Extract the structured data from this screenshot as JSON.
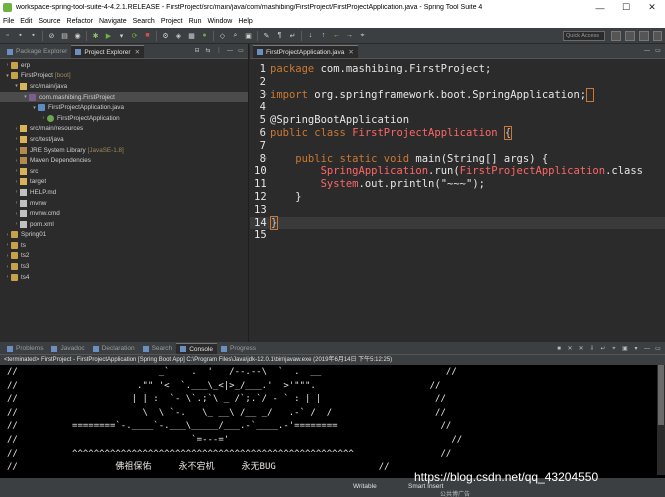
{
  "window": {
    "title": "workspace-spring-tool-suite-4-4.2.1.RELEASE - FirstProject/src/main/java/com/mashibing/FirstProject/FirstProjectApplication.java - Spring Tool Suite 4",
    "controls": [
      "—",
      "☐",
      "✕"
    ]
  },
  "menu": [
    "File",
    "Edit",
    "Source",
    "Refactor",
    "Navigate",
    "Search",
    "Project",
    "Run",
    "Window",
    "Help"
  ],
  "toolbar": {
    "quick_access": "Quick Access"
  },
  "explorer": {
    "tabs": [
      "Package Explorer",
      "Project Explorer"
    ],
    "active_tab": "Project Explorer",
    "items": [
      {
        "label": "erp",
        "extra": "",
        "icon": "project-icon",
        "indent": 0,
        "expanded": false,
        "selected": false
      },
      {
        "label": "FirstProject",
        "extra": "[boot]",
        "icon": "project-icon",
        "indent": 0,
        "expanded": true,
        "selected": false
      },
      {
        "label": "src/main/java",
        "extra": "",
        "icon": "source-folder-icon",
        "indent": 1,
        "expanded": true,
        "selected": false
      },
      {
        "label": "com.mashibing.FirstProject",
        "extra": "",
        "icon": "package-icon",
        "indent": 2,
        "expanded": true,
        "selected": true
      },
      {
        "label": "FirstProjectApplication.java",
        "extra": "",
        "icon": "java-file-icon",
        "indent": 3,
        "expanded": true,
        "selected": false
      },
      {
        "label": "FirstProjectApplication",
        "extra": "",
        "icon": "class-icon",
        "indent": 4,
        "expanded": false,
        "selected": false
      },
      {
        "label": "src/main/resources",
        "extra": "",
        "icon": "source-folder-icon",
        "indent": 1,
        "expanded": false,
        "selected": false
      },
      {
        "label": "src/test/java",
        "extra": "",
        "icon": "source-folder-icon",
        "indent": 1,
        "expanded": false,
        "selected": false
      },
      {
        "label": "JRE System Library",
        "extra": "[JavaSE-1.8]",
        "icon": "library-icon",
        "indent": 1,
        "expanded": false,
        "selected": false
      },
      {
        "label": "Maven Dependencies",
        "extra": "",
        "icon": "library-icon",
        "indent": 1,
        "expanded": false,
        "selected": false
      },
      {
        "label": "src",
        "extra": "",
        "icon": "folder-icon",
        "indent": 1,
        "expanded": false,
        "selected": false
      },
      {
        "label": "target",
        "extra": "",
        "icon": "folder-icon",
        "indent": 1,
        "expanded": false,
        "selected": false
      },
      {
        "label": "HELP.md",
        "extra": "",
        "icon": "file-icon",
        "indent": 1,
        "expanded": false,
        "selected": false
      },
      {
        "label": "mvnw",
        "extra": "",
        "icon": "file-icon",
        "indent": 1,
        "expanded": false,
        "selected": false
      },
      {
        "label": "mvnw.cmd",
        "extra": "",
        "icon": "file-icon",
        "indent": 1,
        "expanded": false,
        "selected": false
      },
      {
        "label": "pom.xml",
        "extra": "",
        "icon": "file-icon",
        "indent": 1,
        "expanded": false,
        "selected": false
      },
      {
        "label": "Spring01",
        "extra": "",
        "icon": "project-icon",
        "indent": 0,
        "expanded": false,
        "selected": false
      },
      {
        "label": "ts",
        "extra": "",
        "icon": "project-icon",
        "indent": 0,
        "expanded": false,
        "selected": false
      },
      {
        "label": "ts2",
        "extra": "",
        "icon": "project-icon",
        "indent": 0,
        "expanded": false,
        "selected": false
      },
      {
        "label": "ts3",
        "extra": "",
        "icon": "project-icon",
        "indent": 0,
        "expanded": false,
        "selected": false
      },
      {
        "label": "ts4",
        "extra": "",
        "icon": "project-icon",
        "indent": 0,
        "expanded": false,
        "selected": false
      }
    ]
  },
  "editor": {
    "tab": "FirstProjectApplication.java",
    "lines": [
      {
        "n": "1",
        "fold": "",
        "parts": [
          [
            "kw",
            "package "
          ],
          [
            "plain",
            "com.mashibing.FirstProject;"
          ]
        ]
      },
      {
        "n": "2",
        "fold": "",
        "parts": []
      },
      {
        "n": "3",
        "fold": "⊕",
        "parts": [
          [
            "kw",
            "import "
          ],
          [
            "plain",
            "org.springframework.boot.SpringApplication;"
          ],
          [
            "box",
            " "
          ]
        ]
      },
      {
        "n": "4",
        "fold": "",
        "parts": []
      },
      {
        "n": "5",
        "fold": "",
        "parts": [
          [
            "plain",
            "@SpringBootApplication"
          ]
        ]
      },
      {
        "n": "6",
        "fold": "",
        "parts": [
          [
            "kw",
            "public class "
          ],
          [
            "cls",
            "FirstProjectApplication "
          ],
          [
            "box",
            "{"
          ]
        ]
      },
      {
        "n": "7",
        "fold": "",
        "parts": []
      },
      {
        "n": "8",
        "fold": "⊖",
        "parts": [
          [
            "kw",
            "    public static void "
          ],
          [
            "plain",
            "main(String[] args) {"
          ]
        ]
      },
      {
        "n": "10",
        "fold": "",
        "parts": [
          [
            "cls",
            "        SpringApplication"
          ],
          [
            "plain",
            ".run("
          ],
          [
            "cls",
            "FirstProjectApplication"
          ],
          [
            "plain",
            ".class"
          ]
        ]
      },
      {
        "n": "11",
        "fold": "",
        "parts": [
          [
            "cls",
            "        System"
          ],
          [
            "plain",
            ".out.println("
          ],
          [
            "str",
            "\"~~~\""
          ],
          [
            "plain",
            ");"
          ]
        ]
      },
      {
        "n": "12",
        "fold": "",
        "parts": [
          [
            "plain",
            "    }"
          ]
        ]
      },
      {
        "n": "13",
        "fold": "",
        "parts": []
      },
      {
        "n": "14",
        "fold": "",
        "parts": [
          [
            "box",
            "}"
          ]
        ]
      },
      {
        "n": "15",
        "fold": "",
        "parts": []
      }
    ]
  },
  "console": {
    "tabs": [
      "Problems",
      "Javadoc",
      "Declaration",
      "Search",
      "Console",
      "Progress"
    ],
    "active_tab": "Console",
    "header": "<terminated> FirstProject - FirstProjectApplication [Spring Boot App] C:\\Program Files\\Java\\jdk-12.0.1\\bin\\javaw.exe (2019年6月14日 下午5:12:25)",
    "lines": [
      "//                          _`    .  '   /--.--\\  `  .  __                       //",
      "//                      .\"\" '<  `.___\\_<|>_/___.'  >'\"\"\".                     //",
      "//                     | | :  `- \\`.;`\\ _ /`;.`/ - ` : | |                     //",
      "//                       \\  \\ `-.   \\_ __\\ /__ _/   .-` /  /                   //",
      "//          ========`-.____`-.___\\_____/___.-`____.-'========                   //",
      "//                                `=---='                                         //",
      "//          ^^^^^^^^^^^^^^^^^^^^^^^^^^^^^^^^^^^^^^^^^^^^^^^^^^^^                //",
      "//                  佛祖保佑     永不宕机     永无BUG                   //"
    ]
  },
  "status": {
    "mode": "Writable",
    "insert": "Smart Insert"
  },
  "watermark": "https://blog.csdn.net/qq_43204550",
  "watermark_sub": "公共博广告"
}
